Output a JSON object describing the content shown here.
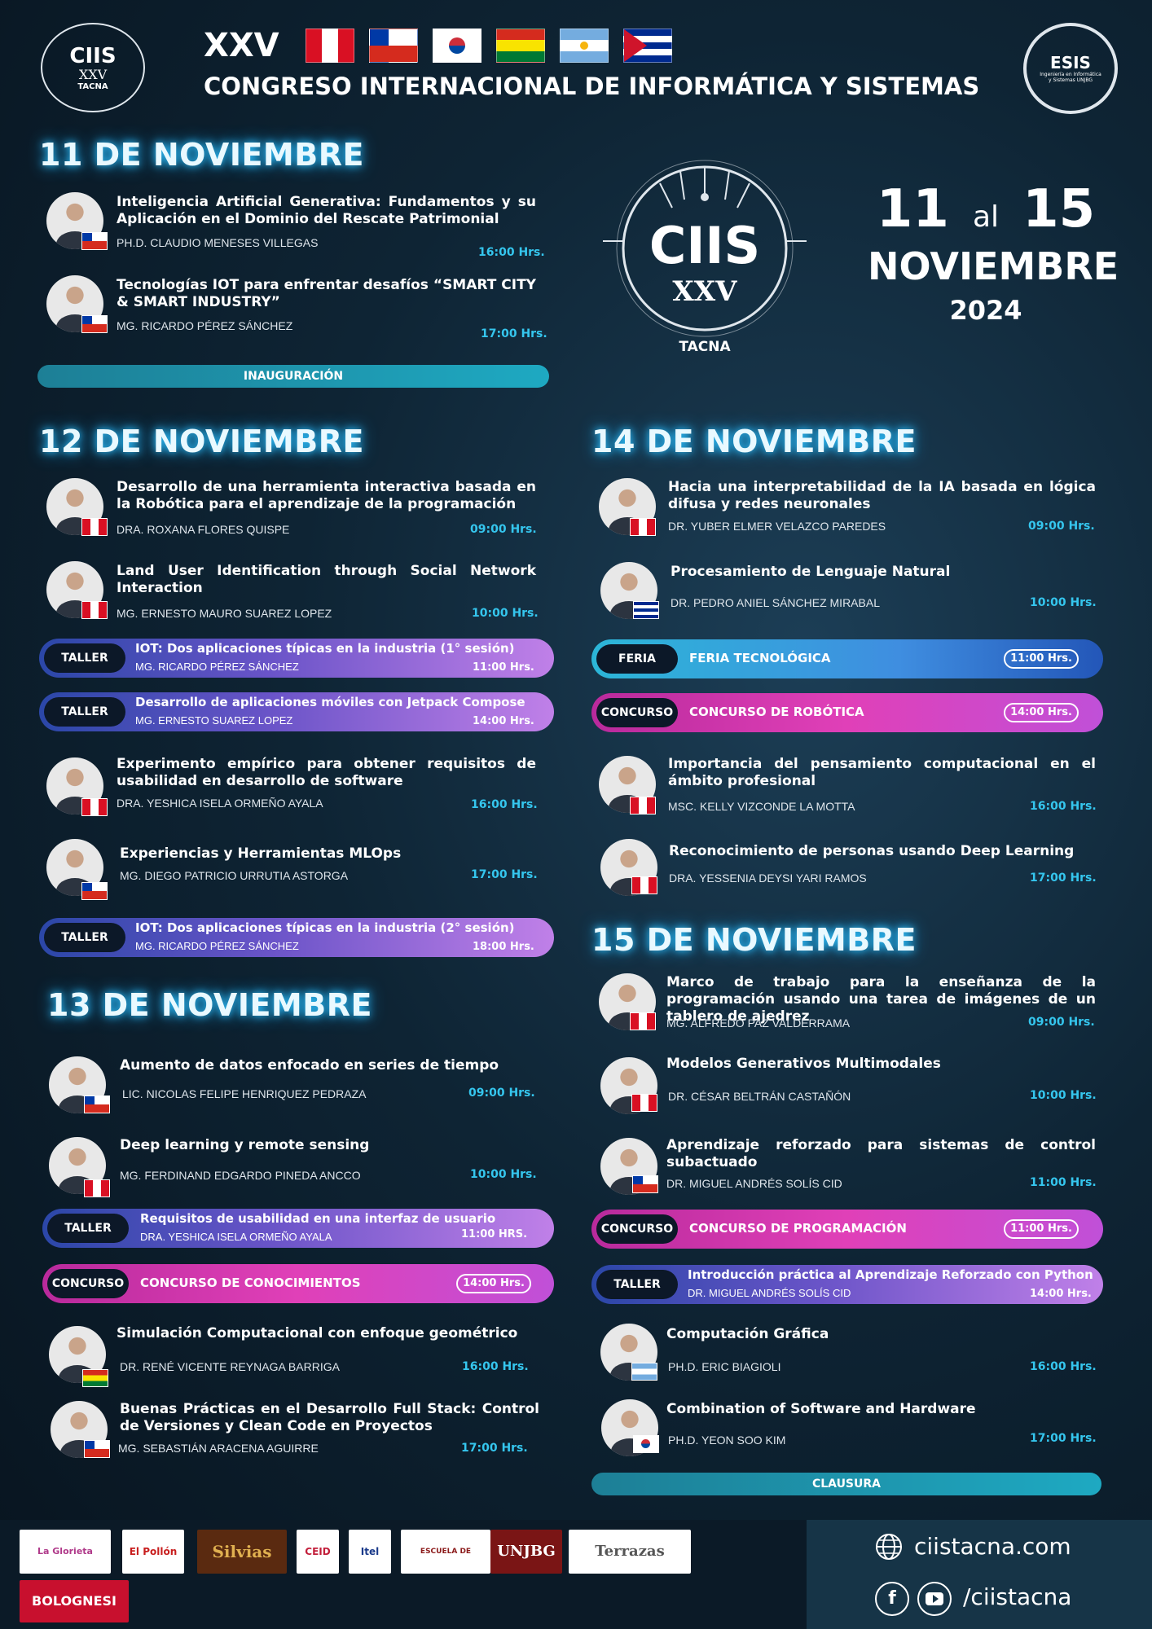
{
  "header": {
    "logo_title": "CIIS",
    "logo_sub": "XXV",
    "logo_city": "TACNA",
    "roman": "XXV",
    "congress": "CONGRESO INTERNACIONAL DE INFORMÁTICA Y SISTEMAS",
    "esis_logo": "ESIS",
    "esis_sub": "Ingeniería en Informática y Sistemas UNJBG",
    "flags": [
      "peru-flag",
      "chile-flag",
      "korea-flag",
      "bolivia-flag",
      "argentina-flag",
      "cuba-flag"
    ]
  },
  "center": {
    "emblem_title": "CIIS",
    "emblem_sub": "XXV",
    "emblem_city": "TACNA",
    "date_from": "11",
    "date_al": "al",
    "date_to": "15",
    "month": "NOVIEMBRE",
    "year": "2024"
  },
  "day11": {
    "title": "11 DE NOVIEMBRE",
    "talks": [
      {
        "title": "Inteligencia Artificial Generativa: Fundamentos y su Aplicación en el Dominio del Rescate Patrimonial",
        "speaker": "PH.D. CLAUDIO MENESES VILLEGAS",
        "time": "16:00 Hrs."
      },
      {
        "title": "Tecnologías IOT para enfrentar desafíos “SMART CITY & SMART INDUSTRY”",
        "speaker": "MG. RICARDO PÉREZ SÁNCHEZ",
        "time": "17:00 Hrs."
      }
    ],
    "bar": "INAUGURACIÓN"
  },
  "day12": {
    "title": "12 DE NOVIEMBRE",
    "talks": [
      {
        "title": "Desarrollo de una herramienta interactiva basada en la Robótica para el aprendizaje de la programación",
        "speaker": "DRA. ROXANA FLORES QUISPE",
        "time": "09:00 Hrs."
      },
      {
        "title": "Land User Identification through Social Network Interaction",
        "speaker": "MG. ERNESTO MAURO SUAREZ LOPEZ",
        "time": "10:00 Hrs."
      },
      {
        "title": "Experimento empírico para obtener requisitos de usabilidad en desarrollo de software",
        "speaker": "DRA. YESHICA ISELA ORMEÑO AYALA",
        "time": "16:00 Hrs."
      },
      {
        "title": "Experiencias y Herramientas MLOps",
        "speaker": "MG. DIEGO PATRICIO URRUTIA ASTORGA",
        "time": "17:00 Hrs."
      }
    ],
    "pills": [
      {
        "tag": "TALLER",
        "title": "IOT: Dos aplicaciones típicas en la industria (1° sesión)",
        "sub": "MG. RICARDO PÉREZ SÁNCHEZ",
        "time": "11:00 Hrs."
      },
      {
        "tag": "TALLER",
        "title": "Desarrollo de aplicaciones móviles con Jetpack Compose",
        "sub": "MG. ERNESTO SUAREZ LOPEZ",
        "time": "14:00 Hrs."
      },
      {
        "tag": "TALLER",
        "title": "IOT: Dos aplicaciones típicas en la industria (2° sesión)",
        "sub": "MG. RICARDO PÉREZ SÁNCHEZ",
        "time": "18:00 Hrs."
      }
    ]
  },
  "day13": {
    "title": "13 DE NOVIEMBRE",
    "talks": [
      {
        "title": "Aumento de datos enfocado en series de tiempo",
        "speaker": "LIC. NICOLAS FELIPE HENRIQUEZ PEDRAZA",
        "time": "09:00 Hrs."
      },
      {
        "title": "Deep learning y remote sensing",
        "speaker": "MG. FERDINAND EDGARDO PINEDA ANCCO",
        "time": "10:00 Hrs."
      },
      {
        "title": "Simulación Computacional con enfoque geométrico",
        "speaker": "DR. RENÉ VICENTE REYNAGA BARRIGA",
        "time": "16:00 Hrs."
      },
      {
        "title": "Buenas Prácticas en el Desarrollo Full Stack: Control de Versiones y Clean Code en Proyectos",
        "speaker": "MG. SEBASTIÁN ARACENA AGUIRRE",
        "time": "17:00 Hrs."
      }
    ],
    "pills": [
      {
        "tag": "TALLER",
        "title": "Requisitos de usabilidad en una interfaz de usuario",
        "sub": "DRA. YESHICA ISELA ORMEÑO AYALA",
        "time": "11:00 HRS."
      },
      {
        "tag": "CONCURSO",
        "title": "CONCURSO DE CONOCIMIENTOS",
        "time": "14:00 Hrs."
      }
    ]
  },
  "day14": {
    "title": "14 DE NOVIEMBRE",
    "talks": [
      {
        "title": "Hacia una interpretabilidad de la IA basada en lógica difusa y redes neuronales",
        "speaker": "DR. YUBER ELMER VELAZCO PAREDES",
        "time": "09:00 Hrs."
      },
      {
        "title": "Procesamiento de Lenguaje Natural",
        "speaker": "DR. PEDRO ANIEL SÁNCHEZ MIRABAL",
        "time": "10:00 Hrs."
      },
      {
        "title": "Importancia del pensamiento computacional en el ámbito profesional",
        "speaker": "MSC. KELLY VIZCONDE LA MOTTA",
        "time": "16:00 Hrs."
      },
      {
        "title": "Reconocimiento de personas usando Deep Learning",
        "speaker": "DRA. YESSENIA DEYSI YARI RAMOS",
        "time": "17:00 Hrs."
      }
    ],
    "pills": [
      {
        "tag": "FERIA",
        "title": "FERIA TECNOLÓGICA",
        "time": "11:00 Hrs."
      },
      {
        "tag": "CONCURSO",
        "title": "CONCURSO DE ROBÓTICA",
        "time": "14:00 Hrs."
      }
    ]
  },
  "day15": {
    "title": "15 DE NOVIEMBRE",
    "talks": [
      {
        "title": "Marco de trabajo para la enseñanza de la programación usando una tarea de imágenes de un tablero de ajedrez",
        "speaker": "MG. ALFREDO PAZ VALDERRAMA",
        "time": "09:00 Hrs."
      },
      {
        "title": "Modelos Generativos Multimodales",
        "speaker": "DR. CÉSAR BELTRÁN CASTAÑÓN",
        "time": "10:00 Hrs."
      },
      {
        "title": "Aprendizaje reforzado para sistemas de control subactuado",
        "speaker": "DR. MIGUEL ANDRÉS SOLÍS CID",
        "time": "11:00 Hrs."
      },
      {
        "title": "Computación Gráfica",
        "speaker": "PH.D. ERIC BIAGIOLI",
        "time": "16:00 Hrs."
      },
      {
        "title": "Combination of Software and Hardware",
        "speaker": "PH.D. YEON SOO KIM",
        "time": "17:00 Hrs."
      }
    ],
    "pills": [
      {
        "tag": "CONCURSO",
        "title": "CONCURSO DE PROGRAMACIÓN",
        "time": "11:00 Hrs."
      },
      {
        "tag": "TALLER",
        "title": "Introducción práctica al Aprendizaje Reforzado con Python",
        "sub": "DR. MIGUEL ANDRÉS SOLÍS CID",
        "time": "14:00 Hrs."
      }
    ],
    "bar": "CLAUSURA"
  },
  "footer": {
    "sponsors": [
      "La Glorieta Tacneña",
      "El Pollón",
      "Silvias",
      "CEID",
      "Itel",
      "ESCUELA DE POSGRADO",
      "UNJBG",
      "Terrazas",
      "BOLOGNESI"
    ],
    "website": "ciistacna.com",
    "social": "/ciistacna"
  }
}
